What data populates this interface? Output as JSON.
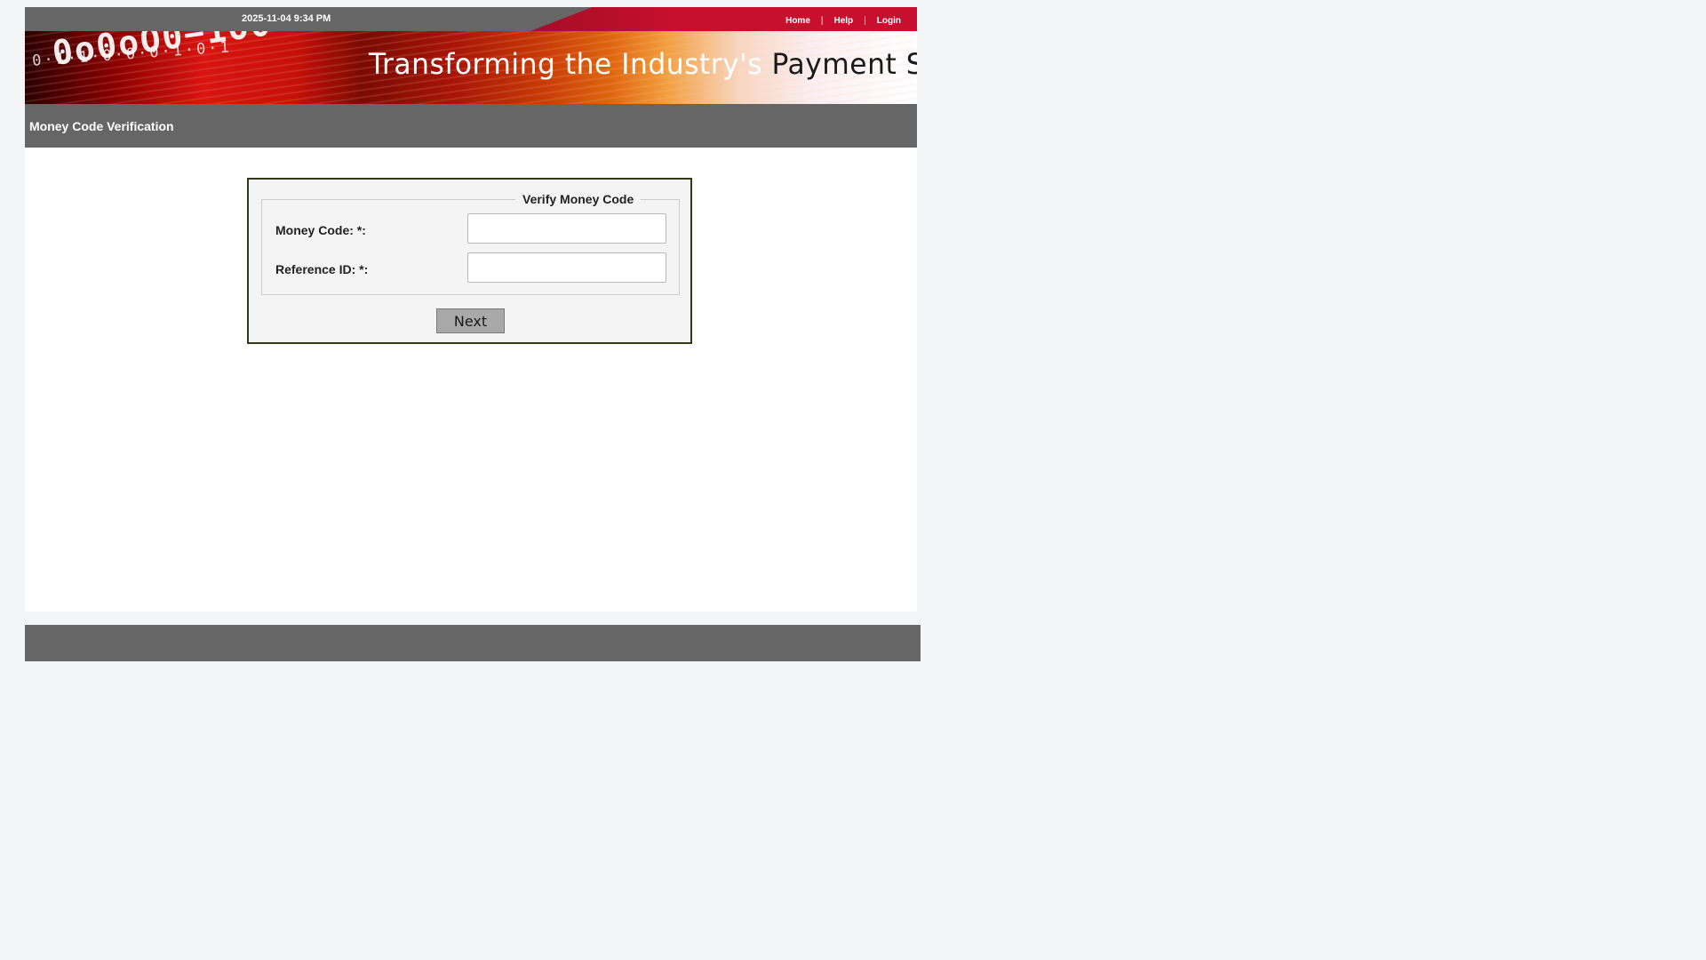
{
  "header": {
    "datetime": "2025-11-04 9:34 PM",
    "links": {
      "home": "Home",
      "help": "Help",
      "login": "Login",
      "separator": "|"
    }
  },
  "banner": {
    "tagline_part1": "Transforming the Industry's",
    "tagline_part2": "Payment Solutions"
  },
  "page": {
    "title": "Money Code Verification"
  },
  "form": {
    "legend": "Verify Money Code",
    "fields": [
      {
        "label": "Money Code: *:",
        "value": "",
        "placeholder": ""
      },
      {
        "label": "Reference ID: *:",
        "value": "",
        "placeholder": ""
      }
    ],
    "next_label": "Next"
  },
  "colors": {
    "header_gray": "#666666",
    "accent_red": "#c8102e",
    "form_border": "#2e3b16",
    "page_background": "#f4f5f7"
  }
}
